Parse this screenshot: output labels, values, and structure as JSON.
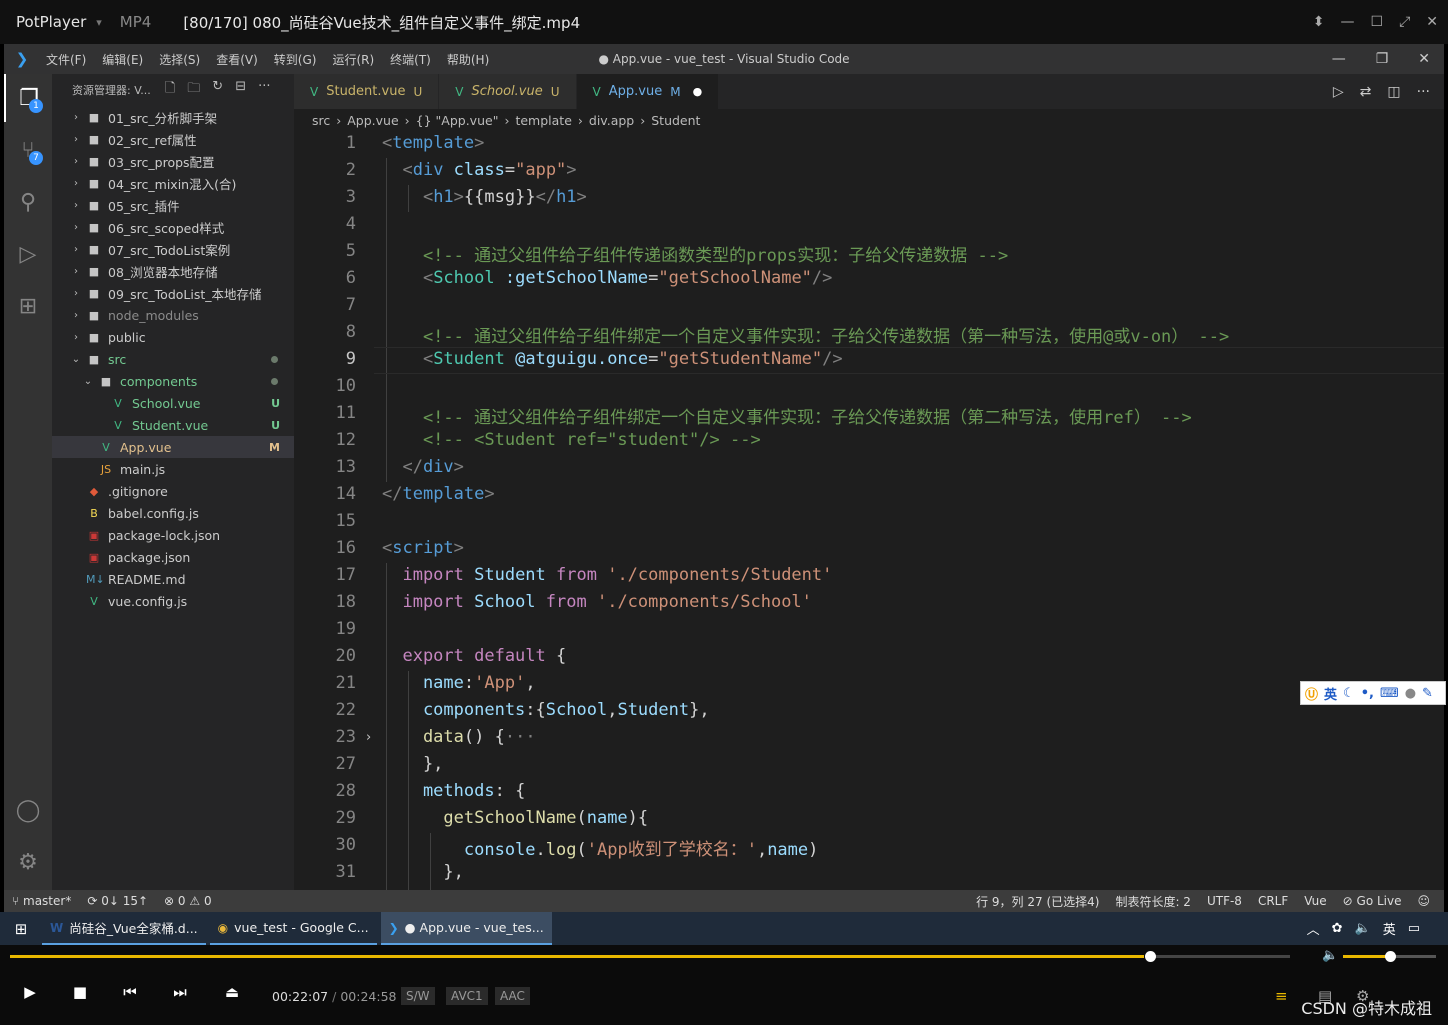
{
  "potplayer": {
    "brand": "PotPlayer",
    "format": "MP4",
    "file_title": "[80/170] 080_尚硅谷Vue技术_组件自定义事件_绑定.mp4",
    "controls": [
      "⬍",
      "—",
      "☐",
      "⤢",
      "✕"
    ]
  },
  "vscode": {
    "menu": [
      "文件(F)",
      "编辑(E)",
      "选择(S)",
      "查看(V)",
      "转到(G)",
      "运行(R)",
      "终端(T)",
      "帮助(H)"
    ],
    "window_title": "● App.vue - vue_test - Visual Studio Code",
    "explorer_title": "资源管理器: V...",
    "badges": {
      "explorer": "1",
      "scm": "7"
    },
    "tree": [
      {
        "label": "01_src_分析脚手架",
        "type": "folder",
        "depth": 0,
        "open": false
      },
      {
        "label": "02_src_ref属性",
        "type": "folder",
        "depth": 0,
        "open": false
      },
      {
        "label": "03_src_props配置",
        "type": "folder",
        "depth": 0,
        "open": false
      },
      {
        "label": "04_src_mixin混入(合)",
        "type": "folder",
        "depth": 0,
        "open": false
      },
      {
        "label": "05_src_插件",
        "type": "folder",
        "depth": 0,
        "open": false
      },
      {
        "label": "06_src_scoped样式",
        "type": "folder",
        "depth": 0,
        "open": false
      },
      {
        "label": "07_src_TodoList案例",
        "type": "folder",
        "depth": 0,
        "open": false
      },
      {
        "label": "08_浏览器本地存储",
        "type": "folder",
        "depth": 0,
        "open": false
      },
      {
        "label": "09_src_TodoList_本地存储",
        "type": "folder",
        "depth": 0,
        "open": false
      },
      {
        "label": "node_modules",
        "type": "folder",
        "depth": 0,
        "open": false,
        "dim": true
      },
      {
        "label": "public",
        "type": "folder",
        "depth": 0,
        "open": false
      },
      {
        "label": "src",
        "type": "folder",
        "depth": 0,
        "open": true,
        "color": "#73c991",
        "dot": true
      },
      {
        "label": "components",
        "type": "folder",
        "depth": 1,
        "open": true,
        "color": "#73c991",
        "dot": true
      },
      {
        "label": "School.vue",
        "type": "vue",
        "depth": 2,
        "color": "#73c991",
        "tag": "U"
      },
      {
        "label": "Student.vue",
        "type": "vue",
        "depth": 2,
        "color": "#73c991",
        "tag": "U"
      },
      {
        "label": "App.vue",
        "type": "vue",
        "depth": 1,
        "color": "#e2c08d",
        "tag": "M",
        "selected": true
      },
      {
        "label": "main.js",
        "type": "js",
        "depth": 1
      },
      {
        "label": ".gitignore",
        "type": "git",
        "depth": 0
      },
      {
        "label": "babel.config.js",
        "type": "babel",
        "depth": 0
      },
      {
        "label": "package-lock.json",
        "type": "npm",
        "depth": 0
      },
      {
        "label": "package.json",
        "type": "npm",
        "depth": 0
      },
      {
        "label": "README.md",
        "type": "md",
        "depth": 0
      },
      {
        "label": "vue.config.js",
        "type": "vue",
        "depth": 0
      }
    ],
    "tabs": [
      {
        "label": "Student.vue",
        "status": "U",
        "active": false,
        "italic": false
      },
      {
        "label": "School.vue",
        "status": "U",
        "active": false,
        "italic": true
      },
      {
        "label": "App.vue",
        "status": "M",
        "active": true,
        "dirty": true
      }
    ],
    "breadcrumb": [
      "src",
      "App.vue",
      "{} \"App.vue\"",
      "template",
      "div.app",
      "Student"
    ],
    "current_line": 9,
    "code_lines": [
      {
        "n": "1",
        "t": [
          [
            "<",
            "#808080"
          ],
          [
            "template",
            "#569cd6"
          ],
          [
            ">",
            "#808080"
          ]
        ]
      },
      {
        "n": "2",
        "t": [
          [
            "  <",
            "#808080"
          ],
          [
            "div ",
            "#569cd6"
          ],
          [
            "class",
            "#9cdcfe"
          ],
          [
            "=",
            "#d4d4d4"
          ],
          [
            "\"app\"",
            "#ce9178"
          ],
          [
            ">",
            "#808080"
          ]
        ]
      },
      {
        "n": "3",
        "t": [
          [
            "    <",
            "#808080"
          ],
          [
            "h1",
            "#569cd6"
          ],
          [
            ">",
            "#808080"
          ],
          [
            "{{msg}}",
            "#d4d4d4"
          ],
          [
            "</",
            "#808080"
          ],
          [
            "h1",
            "#569cd6"
          ],
          [
            ">",
            "#808080"
          ]
        ]
      },
      {
        "n": "4",
        "t": []
      },
      {
        "n": "5",
        "t": [
          [
            "    <!-- 通过父组件给子组件传递函数类型的props实现：子给父传递数据 -->",
            "#6a9955"
          ]
        ]
      },
      {
        "n": "6",
        "t": [
          [
            "    <",
            "#808080"
          ],
          [
            "School ",
            "#4ec9b0"
          ],
          [
            ":getSchoolName",
            "#9cdcfe"
          ],
          [
            "=",
            "#d4d4d4"
          ],
          [
            "\"getSchoolName\"",
            "#ce9178"
          ],
          [
            "/>",
            "#808080"
          ]
        ]
      },
      {
        "n": "7",
        "t": []
      },
      {
        "n": "8",
        "t": [
          [
            "    <!-- 通过父组件给子组件绑定一个自定义事件实现：子给父传递数据（第一种写法，使用@或v-on） -->",
            "#6a9955"
          ]
        ]
      },
      {
        "n": "9",
        "t": [
          [
            "    <",
            "#808080"
          ],
          [
            "Student ",
            "#4ec9b0"
          ],
          [
            "@atguigu.once",
            "#9cdcfe"
          ],
          [
            "=",
            "#d4d4d4"
          ],
          [
            "\"getStudentName\"",
            "#ce9178"
          ],
          [
            "/>",
            "#808080"
          ]
        ]
      },
      {
        "n": "10",
        "t": []
      },
      {
        "n": "11",
        "t": [
          [
            "    <!-- 通过父组件给子组件绑定一个自定义事件实现：子给父传递数据（第二种写法，使用ref） -->",
            "#6a9955"
          ]
        ]
      },
      {
        "n": "12",
        "t": [
          [
            "    <!-- <Student ref=\"student\"/> -->",
            "#6a9955"
          ]
        ]
      },
      {
        "n": "13",
        "t": [
          [
            "  </",
            "#808080"
          ],
          [
            "div",
            "#569cd6"
          ],
          [
            ">",
            "#808080"
          ]
        ]
      },
      {
        "n": "14",
        "t": [
          [
            "</",
            "#808080"
          ],
          [
            "template",
            "#569cd6"
          ],
          [
            ">",
            "#808080"
          ]
        ]
      },
      {
        "n": "15",
        "t": []
      },
      {
        "n": "16",
        "t": [
          [
            "<",
            "#808080"
          ],
          [
            "script",
            "#569cd6"
          ],
          [
            ">",
            "#808080"
          ]
        ]
      },
      {
        "n": "17",
        "t": [
          [
            "  import ",
            "#c586c0"
          ],
          [
            "Student ",
            "#9cdcfe"
          ],
          [
            "from ",
            "#c586c0"
          ],
          [
            "'./components/Student'",
            "#ce9178"
          ]
        ]
      },
      {
        "n": "18",
        "t": [
          [
            "  import ",
            "#c586c0"
          ],
          [
            "School ",
            "#9cdcfe"
          ],
          [
            "from ",
            "#c586c0"
          ],
          [
            "'./components/School'",
            "#ce9178"
          ]
        ]
      },
      {
        "n": "19",
        "t": []
      },
      {
        "n": "20",
        "t": [
          [
            "  export default ",
            "#c586c0"
          ],
          [
            "{",
            "#d4d4d4"
          ]
        ]
      },
      {
        "n": "21",
        "t": [
          [
            "    name",
            "#9cdcfe"
          ],
          [
            ":",
            "#d4d4d4"
          ],
          [
            "'App'",
            "#ce9178"
          ],
          [
            ",",
            "#d4d4d4"
          ]
        ]
      },
      {
        "n": "22",
        "t": [
          [
            "    components",
            "#9cdcfe"
          ],
          [
            ":{",
            "#d4d4d4"
          ],
          [
            "School",
            "#9cdcfe"
          ],
          [
            ",",
            "#d4d4d4"
          ],
          [
            "Student",
            "#9cdcfe"
          ],
          [
            "},",
            "#d4d4d4"
          ]
        ]
      },
      {
        "n": "23",
        "t": [
          [
            "    data",
            "#dcdcaa"
          ],
          [
            "() {",
            "#d4d4d4"
          ],
          [
            "···",
            "#808080"
          ]
        ]
      },
      {
        "n": "27",
        "t": [
          [
            "    },",
            "#d4d4d4"
          ]
        ]
      },
      {
        "n": "28",
        "t": [
          [
            "    methods",
            "#9cdcfe"
          ],
          [
            ": {",
            "#d4d4d4"
          ]
        ]
      },
      {
        "n": "29",
        "t": [
          [
            "      getSchoolName",
            "#dcdcaa"
          ],
          [
            "(",
            "#d4d4d4"
          ],
          [
            "name",
            "#9cdcfe"
          ],
          [
            "){",
            "#d4d4d4"
          ]
        ]
      },
      {
        "n": "30",
        "t": [
          [
            "        console",
            "#9cdcfe"
          ],
          [
            ".",
            "#d4d4d4"
          ],
          [
            "log",
            "#dcdcaa"
          ],
          [
            "(",
            "#d4d4d4"
          ],
          [
            "'App收到了学校名：'",
            "#ce9178"
          ],
          [
            ",",
            "#d4d4d4"
          ],
          [
            "name",
            "#9cdcfe"
          ],
          [
            ")",
            "#d4d4d4"
          ]
        ]
      },
      {
        "n": "31",
        "t": [
          [
            "      },",
            "#d4d4d4"
          ]
        ]
      }
    ],
    "status": {
      "branch": "master*",
      "sync": "0↓ 15↑",
      "errors": "0",
      "warnings": "0",
      "position": "行 9，列 27 (已选择4)",
      "tab_size": "制表符长度: 2",
      "encoding": "UTF-8",
      "eol": "CRLF",
      "language": "Vue",
      "golive": "Go Live"
    }
  },
  "ime": {
    "mode": "英"
  },
  "taskbar": {
    "items": [
      {
        "label": "尚硅谷_Vue全家桶.d...",
        "icon": "word-icon"
      },
      {
        "label": "vue_test - Google C...",
        "icon": "chrome-icon"
      },
      {
        "label": "● App.vue - vue_tes...",
        "icon": "vscode-icon",
        "active": true
      }
    ],
    "lang": "英"
  },
  "player": {
    "current_time": "00:22:07",
    "total_time": "00:24:58",
    "progress": 0.886,
    "volume": 0.5,
    "chips": [
      "S/W",
      "AVC1",
      "AAC"
    ],
    "watermark": "CSDN @特木成祖"
  },
  "colors": {
    "accent": "#e9b800",
    "vscode_blue": "#007acc"
  }
}
